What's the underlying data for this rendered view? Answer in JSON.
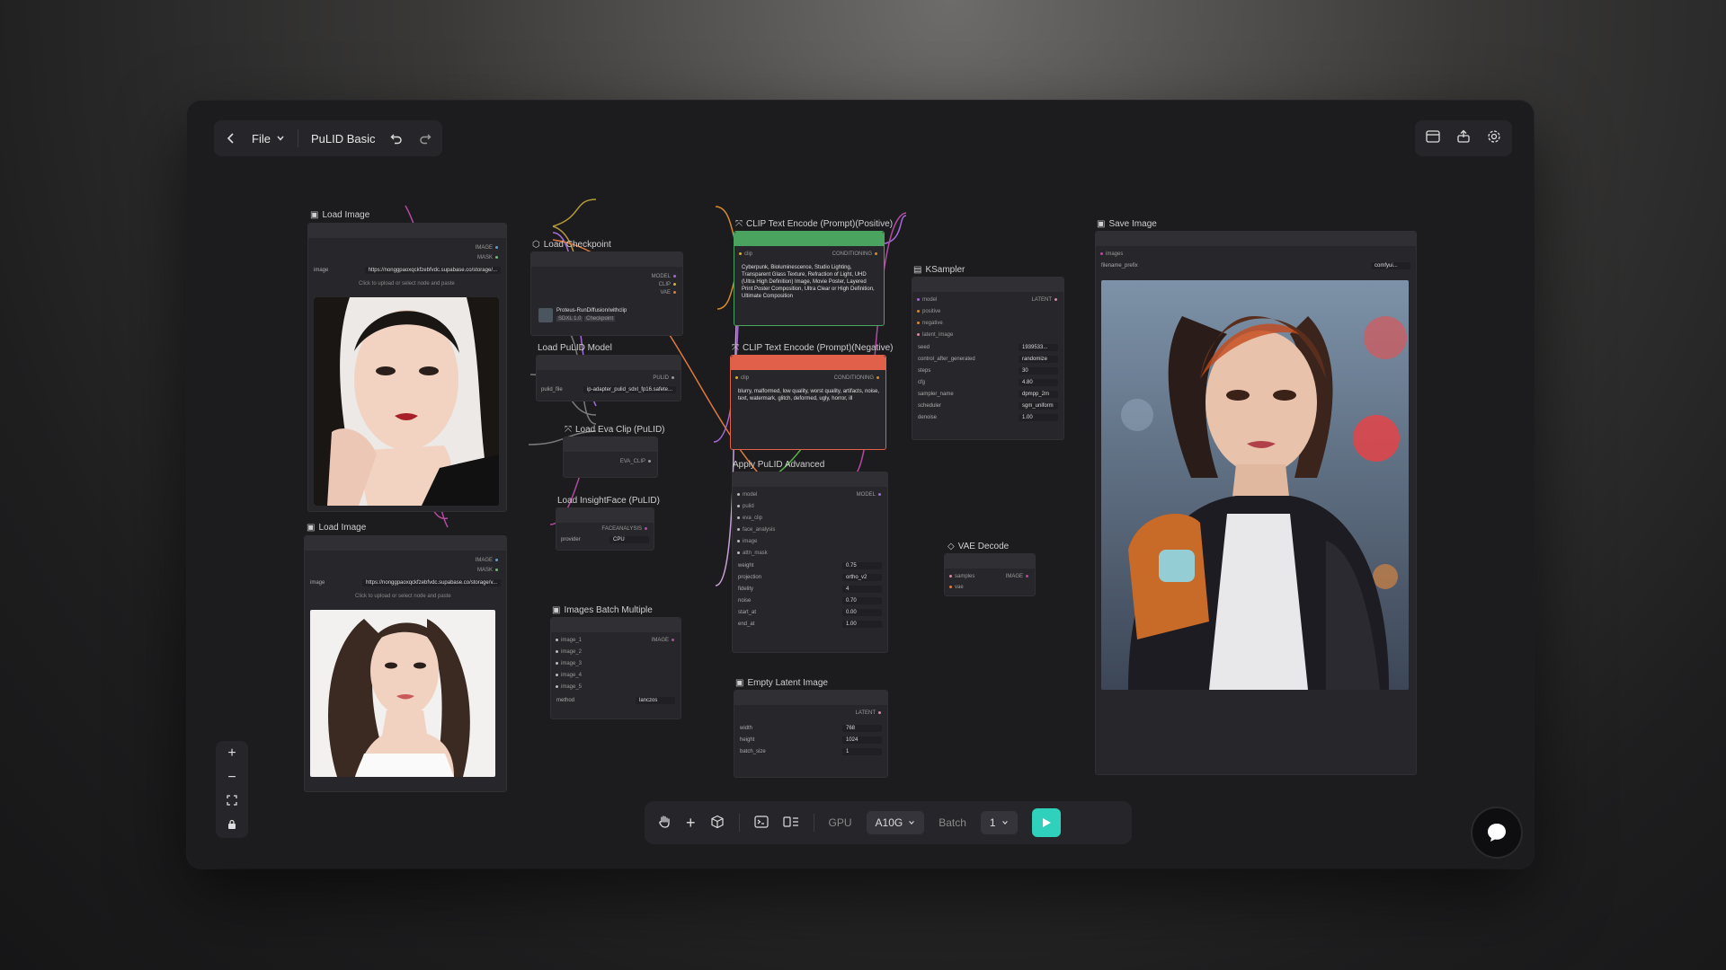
{
  "toolbar": {
    "file_label": "File",
    "workflow_name": "PuLID Basic"
  },
  "nodes": {
    "load_image_1": {
      "title": "Load Image",
      "out_image": "IMAGE",
      "out_mask": "MASK",
      "image_label": "image",
      "image_value": "https://nonggpaoxqckfzebfvdc.supabase.co/storage/...",
      "upload_hint": "Click to upload or select node and paste"
    },
    "load_image_2": {
      "title": "Load Image",
      "out_image": "IMAGE",
      "out_mask": "MASK",
      "image_label": "image",
      "image_value": "https://nonggpaoxqckfzebfvdc.supabase.co/storage/v...",
      "upload_hint": "Click to upload or select node and paste"
    },
    "load_checkpoint": {
      "title": "Load Checkpoint",
      "out_model": "MODEL",
      "out_clip": "CLIP",
      "out_vae": "VAE",
      "ckpt_name": "Proteus-RunDiffusion/withclip",
      "tag1": "SDXL 1.0",
      "tag2": "Checkpoint"
    },
    "load_pulid_model": {
      "title": "Load PuLID Model",
      "out_pulid": "PULID",
      "file_label": "pulid_file",
      "file_value": "ip-adapter_pulid_sdxl_fp16.safete..."
    },
    "load_eva_clip": {
      "title": "Load Eva Clip (PuLID)",
      "out": "EVA_CLIP"
    },
    "load_insightface": {
      "title": "Load InsightFace (PuLID)",
      "out": "FACEANALYSIS",
      "provider_label": "provider",
      "provider_value": "CPU"
    },
    "clip_positive": {
      "title": "CLIP Text Encode (Prompt)(Positive)",
      "in_clip": "clip",
      "out": "CONDITIONING",
      "text": "Cyberpunk,   Bioluminescence,   Studio Lighting,   Transparent Glass Texture,   Refraction of Light,   UHD (Ultra High Definition) Image,   Movie Poster,   Layered Print Poster Composition,   Ultra Clear or High Definition,   Ultimate Composition"
    },
    "clip_negative": {
      "title": "CLIP Text Encode (Prompt)(Negative)",
      "in_clip": "clip",
      "out": "CONDITIONING",
      "text": "blurry, malformed, low quality, worst quality, artifacts, noise, text, watermark, glitch, deformed, ugly, horror, ill"
    },
    "ksampler": {
      "title": "KSampler",
      "inputs": [
        "model",
        "positive",
        "negative",
        "latent_image"
      ],
      "out": "LATENT",
      "fields": [
        {
          "label": "seed",
          "value": "1939533..."
        },
        {
          "label": "control_after_generated",
          "value": "randomize"
        },
        {
          "label": "steps",
          "value": "30"
        },
        {
          "label": "cfg",
          "value": "4.80"
        },
        {
          "label": "sampler_name",
          "value": "dpmpp_2m"
        },
        {
          "label": "scheduler",
          "value": "sgm_uniform"
        },
        {
          "label": "denoise",
          "value": "1.00"
        }
      ]
    },
    "apply_pulid": {
      "title": "Apply PuLID Advanced",
      "inputs": [
        "model",
        "pulid",
        "eva_clip",
        "face_analysis",
        "image",
        "attn_mask"
      ],
      "out": "MODEL",
      "fields": [
        {
          "label": "weight",
          "value": "0.75"
        },
        {
          "label": "projection",
          "value": "ortho_v2"
        },
        {
          "label": "fidelity",
          "value": "4"
        },
        {
          "label": "noise",
          "value": "0.70"
        },
        {
          "label": "start_at",
          "value": "0.00"
        },
        {
          "label": "end_at",
          "value": "1.00"
        }
      ]
    },
    "images_batch": {
      "title": "Images Batch Multiple",
      "inputs": [
        "image_1",
        "image_2",
        "image_3",
        "image_4",
        "image_5"
      ],
      "out": "IMAGE",
      "method_label": "method",
      "method_value": "lanczos"
    },
    "empty_latent": {
      "title": "Empty Latent Image",
      "out": "LATENT",
      "fields": [
        {
          "label": "width",
          "value": "768"
        },
        {
          "label": "height",
          "value": "1024"
        },
        {
          "label": "batch_size",
          "value": "1"
        }
      ]
    },
    "vae_decode": {
      "title": "VAE Decode",
      "inputs": [
        "samples",
        "vae"
      ],
      "out": "IMAGE"
    },
    "save_image": {
      "title": "Save Image",
      "in": "images",
      "prefix_label": "filename_prefix",
      "prefix_value": "comfyui..."
    }
  },
  "bottombar": {
    "gpu_label": "GPU",
    "gpu_value": "A10G",
    "batch_label": "Batch",
    "batch_value": "1"
  },
  "colors": {
    "positive": "#4aa35e",
    "negative": "#e0604a",
    "run": "#2fd1bc"
  },
  "icons": [
    "back-icon",
    "chevron-down-icon",
    "undo-icon",
    "redo-icon",
    "panel-icon",
    "share-icon",
    "gear-icon",
    "plus-icon",
    "minus-icon",
    "fit-icon",
    "lock-icon",
    "hand-icon",
    "cube-icon",
    "terminal-icon",
    "queue-icon",
    "play-icon",
    "chat-icon"
  ]
}
